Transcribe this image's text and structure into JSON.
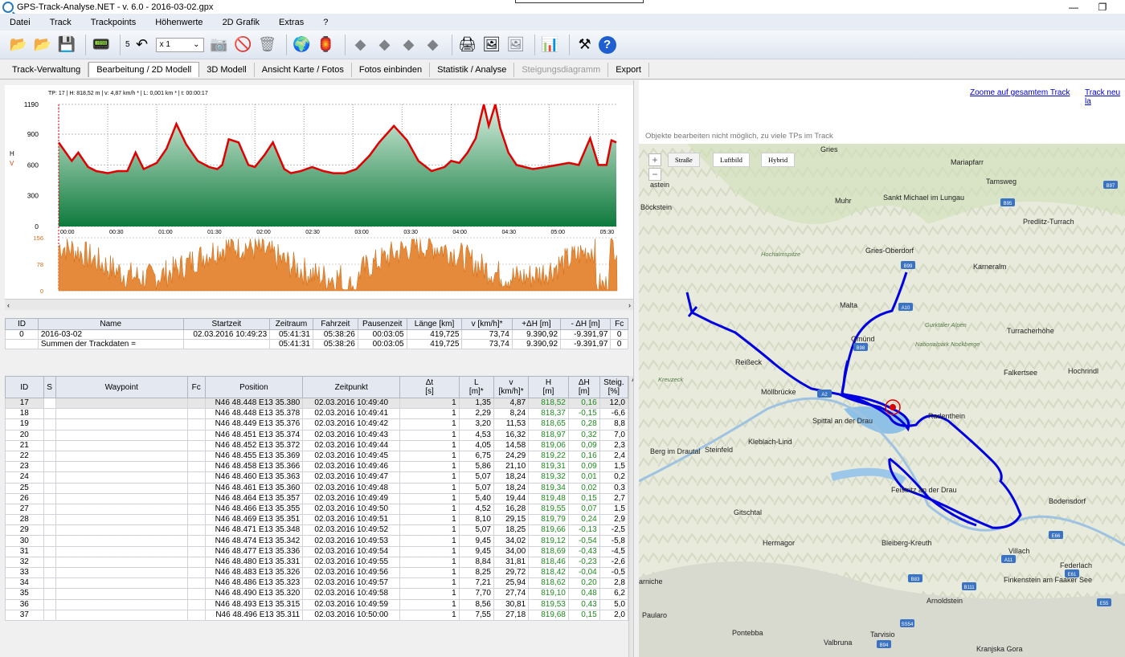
{
  "window": {
    "title": "GPS-Track-Analyse.NET  -  v. 6.0  -  2016-03-02.gpx",
    "minimize": "—",
    "restore": "❐"
  },
  "menu": [
    "Datei",
    "Track",
    "Trackpoints",
    "Höhenwerte",
    "2D Grafik",
    "Extras",
    "?"
  ],
  "toolbar": {
    "step_label": "5",
    "zoom_select": "x 1"
  },
  "tabs": [
    {
      "label": "Track-Verwaltung",
      "state": "normal"
    },
    {
      "label": "Bearbeitung / 2D Modell",
      "state": "active"
    },
    {
      "label": "3D Modell",
      "state": "normal"
    },
    {
      "label": "Ansicht Karte / Fotos",
      "state": "normal"
    },
    {
      "label": "Fotos einbinden",
      "state": "normal"
    },
    {
      "label": "Statistik / Analyse",
      "state": "normal"
    },
    {
      "label": "Steigungsdiagramm",
      "state": "disabled"
    },
    {
      "label": "Export",
      "state": "normal"
    }
  ],
  "chart_data": {
    "type": "area",
    "info": "TP: 17 | H: 818,52 m | v: 4,87 km/h * | L: 0,001 km * | t: 00:00:17",
    "y_axis_letters": [
      "H",
      "V"
    ],
    "elevation": {
      "yticks": [
        "1190",
        "900",
        "600",
        "300",
        "0"
      ],
      "ylim": [
        0,
        1190
      ],
      "xticks": [
        "00:00",
        "00:30",
        "01:00",
        "01:30",
        "02:00",
        "02:30",
        "03:00",
        "03:30",
        "04:00",
        "04:30",
        "05:00",
        "05:30"
      ],
      "xlim_min": [
        0,
        341.5
      ],
      "x_min": [
        0,
        8,
        12,
        18,
        23,
        30,
        36,
        42,
        47,
        52,
        60,
        66,
        72,
        78,
        85,
        92,
        97,
        100,
        104,
        110,
        116,
        120,
        126,
        131,
        138,
        142,
        148,
        155,
        162,
        168,
        175,
        182,
        190,
        196,
        205,
        213,
        220,
        228,
        236,
        240,
        245,
        250,
        255,
        260,
        263,
        267,
        270,
        275,
        280,
        290,
        298,
        305,
        312,
        318,
        325,
        330,
        335,
        338,
        341
      ],
      "height_m": [
        819,
        640,
        720,
        580,
        540,
        520,
        540,
        540,
        720,
        560,
        620,
        760,
        1000,
        800,
        640,
        580,
        560,
        600,
        850,
        820,
        600,
        580,
        700,
        820,
        560,
        520,
        540,
        580,
        540,
        520,
        520,
        560,
        690,
        820,
        980,
        840,
        640,
        540,
        580,
        640,
        620,
        720,
        860,
        1190,
        980,
        1190,
        960,
        720,
        600,
        560,
        580,
        600,
        620,
        600,
        860,
        600,
        600,
        840,
        820
      ]
    },
    "speed": {
      "yticks": [
        "156",
        "78",
        "0"
      ],
      "ylim": [
        0,
        156
      ],
      "unit": "km/h"
    }
  },
  "track_table": {
    "headers": [
      "ID",
      "Name",
      "Startzeit",
      "Zeitraum",
      "Fahrzeit",
      "Pausenzeit",
      "Länge  [km]",
      "v  [km/h]*",
      "+ΔH  [m]",
      "- ΔH  [m]",
      "Fc"
    ],
    "rows": [
      [
        "0",
        "2016-03-02",
        "02.03.2016 10:49:23",
        "05:41:31",
        "05:38:26",
        "00:03:05",
        "419,725",
        "73,74",
        "9.390,92",
        "-9.391,97",
        "0"
      ],
      [
        "",
        "Summen der Trackdaten =",
        "",
        "05:41:31",
        "05:38:26",
        "00:03:05",
        "419,725",
        "73,74",
        "9.390,92",
        "-9.391,97",
        "0"
      ]
    ]
  },
  "waypoint_table": {
    "headers": [
      "ID",
      "S",
      "Waypoint",
      "Fc",
      "Position",
      "Zeitpunkt",
      "Δt\n[s]",
      "L\n[m]*",
      "v\n[km/h]*",
      "H\n[m]",
      "ΔH\n[m]",
      "Steig.\n[%]"
    ],
    "rows": [
      [
        "17",
        "",
        "",
        "",
        "N46 48.448 E13 35.380",
        "02.03.2016 10:49:40",
        "1",
        "1,35",
        "4,87",
        "818,52",
        "0,16",
        "12,0"
      ],
      [
        "18",
        "",
        "",
        "",
        "N46 48.448 E13 35.378",
        "02.03.2016 10:49:41",
        "1",
        "2,29",
        "8,24",
        "818,37",
        "-0,15",
        "-6,6"
      ],
      [
        "19",
        "",
        "",
        "",
        "N46 48.449 E13 35.376",
        "02.03.2016 10:49:42",
        "1",
        "3,20",
        "11,53",
        "818,65",
        "0,28",
        "8,8"
      ],
      [
        "20",
        "",
        "",
        "",
        "N46 48.451 E13 35.374",
        "02.03.2016 10:49:43",
        "1",
        "4,53",
        "16,32",
        "818,97",
        "0,32",
        "7,0"
      ],
      [
        "21",
        "",
        "",
        "",
        "N46 48.452 E13 35.372",
        "02.03.2016 10:49:44",
        "1",
        "4,05",
        "14,58",
        "819,06",
        "0,09",
        "2,3"
      ],
      [
        "22",
        "",
        "",
        "",
        "N46 48.455 E13 35.369",
        "02.03.2016 10:49:45",
        "1",
        "6,75",
        "24,29",
        "819,22",
        "0,16",
        "2,4"
      ],
      [
        "23",
        "",
        "",
        "",
        "N46 48.458 E13 35.366",
        "02.03.2016 10:49:46",
        "1",
        "5,86",
        "21,10",
        "819,31",
        "0,09",
        "1,5"
      ],
      [
        "24",
        "",
        "",
        "",
        "N46 48.460 E13 35.363",
        "02.03.2016 10:49:47",
        "1",
        "5,07",
        "18,24",
        "819,32",
        "0,01",
        "0,2"
      ],
      [
        "25",
        "",
        "",
        "",
        "N46 48.461 E13 35.360",
        "02.03.2016 10:49:48",
        "1",
        "5,07",
        "18,24",
        "819,34",
        "0,02",
        "0,3"
      ],
      [
        "26",
        "",
        "",
        "",
        "N46 48.464 E13 35.357",
        "02.03.2016 10:49:49",
        "1",
        "5,40",
        "19,44",
        "819,48",
        "0,15",
        "2,7"
      ],
      [
        "27",
        "",
        "",
        "",
        "N46 48.466 E13 35.355",
        "02.03.2016 10:49:50",
        "1",
        "4,52",
        "16,28",
        "819,55",
        "0,07",
        "1,5"
      ],
      [
        "28",
        "",
        "",
        "",
        "N46 48.469 E13 35.351",
        "02.03.2016 10:49:51",
        "1",
        "8,10",
        "29,15",
        "819,79",
        "0,24",
        "2,9"
      ],
      [
        "29",
        "",
        "",
        "",
        "N46 48.471 E13 35.348",
        "02.03.2016 10:49:52",
        "1",
        "5,07",
        "18,25",
        "819,66",
        "-0,13",
        "-2,5"
      ],
      [
        "30",
        "",
        "",
        "",
        "N46 48.474 E13 35.342",
        "02.03.2016 10:49:53",
        "1",
        "9,45",
        "34,02",
        "819,12",
        "-0,54",
        "-5,8"
      ],
      [
        "31",
        "",
        "",
        "",
        "N46 48.477 E13 35.336",
        "02.03.2016 10:49:54",
        "1",
        "9,45",
        "34,00",
        "818,69",
        "-0,43",
        "-4,5"
      ],
      [
        "32",
        "",
        "",
        "",
        "N46 48.480 E13 35.331",
        "02.03.2016 10:49:55",
        "1",
        "8,84",
        "31,81",
        "818,46",
        "-0,23",
        "-2,6"
      ],
      [
        "33",
        "",
        "",
        "",
        "N46 48.483 E13 35.326",
        "02.03.2016 10:49:56",
        "1",
        "8,25",
        "29,72",
        "818,42",
        "-0,04",
        "-0,5"
      ],
      [
        "34",
        "",
        "",
        "",
        "N46 48.486 E13 35.323",
        "02.03.2016 10:49:57",
        "1",
        "7,21",
        "25,94",
        "818,62",
        "0,20",
        "2,8"
      ],
      [
        "35",
        "",
        "",
        "",
        "N46 48.490 E13 35.320",
        "02.03.2016 10:49:58",
        "1",
        "7,70",
        "27,74",
        "819,10",
        "0,48",
        "6,2"
      ],
      [
        "36",
        "",
        "",
        "",
        "N46 48.493 E13 35.315",
        "02.03.2016 10:49:59",
        "1",
        "8,56",
        "30,81",
        "819,53",
        "0,43",
        "5,0"
      ],
      [
        "37",
        "",
        "",
        "",
        "N46 48.496 E13 35.311",
        "02.03.2016 10:50:00",
        "1",
        "7,55",
        "27,18",
        "819,68",
        "0,15",
        "2,0"
      ]
    ]
  },
  "map": {
    "link_zoom": "Zoome auf gesamtem Track",
    "link_new": "Track neu la",
    "note": "Objekte bearbeiten nicht möglich, zu viele TPs im Track",
    "types": [
      "Straße",
      "Luftbild",
      "Hybrid"
    ],
    "places": [
      {
        "name": "Mariapfarr"
      },
      {
        "name": "Tamsweg"
      },
      {
        "name": "Muhr"
      },
      {
        "name": "Sankt Michael im Lungau"
      },
      {
        "name": "Böckstein"
      },
      {
        "name": "Predlitz-Turrach"
      },
      {
        "name": "Gries-Oberdorf"
      },
      {
        "name": "Hochalmspitze"
      },
      {
        "name": "Karneralm"
      },
      {
        "name": "Malta"
      },
      {
        "name": "Gurktaler Alpen"
      },
      {
        "name": "Turracherhöhe"
      },
      {
        "name": "Gmünd"
      },
      {
        "name": "Nationalpark Nockberge"
      },
      {
        "name": "Reißeck"
      },
      {
        "name": "Falkertsee"
      },
      {
        "name": "Hochrindl"
      },
      {
        "name": "Kreuzeck"
      },
      {
        "name": "Möllbrücke"
      },
      {
        "name": "Radenthein"
      },
      {
        "name": "Spittal an der Drau"
      },
      {
        "name": "Kleblach-Lind"
      },
      {
        "name": "Berg im Drautal"
      },
      {
        "name": "Steinfeld"
      },
      {
        "name": "Feistritz an der Drau"
      },
      {
        "name": "Bodensdorf"
      },
      {
        "name": "Gitschtal"
      },
      {
        "name": "Hermagor"
      },
      {
        "name": "Bleiberg-Kreuth"
      },
      {
        "name": "Villach"
      },
      {
        "name": "Federlach"
      },
      {
        "name": "Finkenstein am Faaker See"
      },
      {
        "name": "Arnoldstein"
      },
      {
        "name": "Paularo"
      },
      {
        "name": "Pontebba"
      },
      {
        "name": "Tarvisio"
      },
      {
        "name": "Valbruna"
      },
      {
        "name": "Kranjska Gora"
      },
      {
        "name": "Gries"
      },
      {
        "name": "astein"
      },
      {
        "name": "arniche"
      }
    ],
    "road_labels": [
      "B95",
      "B97",
      "B99",
      "A10",
      "B98",
      "A2",
      "B111",
      "B83",
      "A11",
      "E61",
      "E55",
      "SS54",
      "B94",
      "E66"
    ]
  }
}
